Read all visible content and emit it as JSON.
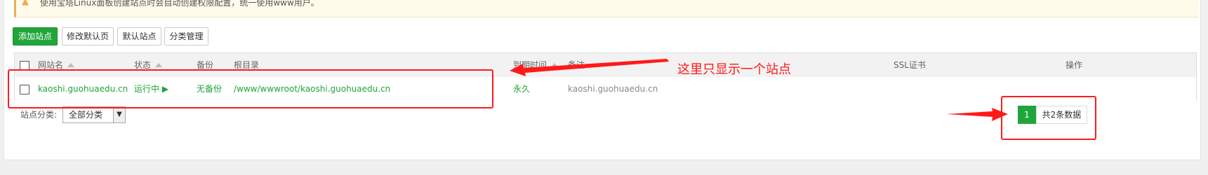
{
  "notice": {
    "icon": "warning-icon",
    "text": "使用宝塔Linux面板创建站点时会自动创建权限配置，统一使用www用户。"
  },
  "toolbar": {
    "add_site": "添加站点",
    "edit_default_page": "修改默认页",
    "default_site": "默认站点",
    "category_manage": "分类管理"
  },
  "table": {
    "headers": {
      "site_name": "网站名",
      "status": "状态",
      "backup": "备份",
      "root_dir": "根目录",
      "expire": "到期时间",
      "remark": "备注",
      "ssl": "SSL证书",
      "action": "操作"
    },
    "rows": [
      {
        "site_name": "kaoshi.guohuaedu.cn",
        "status": "运行中",
        "status_icon": "play-icon",
        "backup": "无备份",
        "root_dir": "/www/wwwroot/kaoshi.guohuaedu.cn",
        "expire": "永久",
        "remark": "kaoshi.guohuaedu.cn"
      }
    ]
  },
  "footer": {
    "category_label": "站点分类:",
    "category_value": "全部分类",
    "current_page": "1",
    "total_text": "共2条数据"
  },
  "annotation": {
    "text": "这里只显示一个站点",
    "color": "#ff1a1a"
  },
  "colors": {
    "accent": "#20a53a",
    "annotation": "#ff1a1a",
    "warning": "#f0ad4e"
  }
}
